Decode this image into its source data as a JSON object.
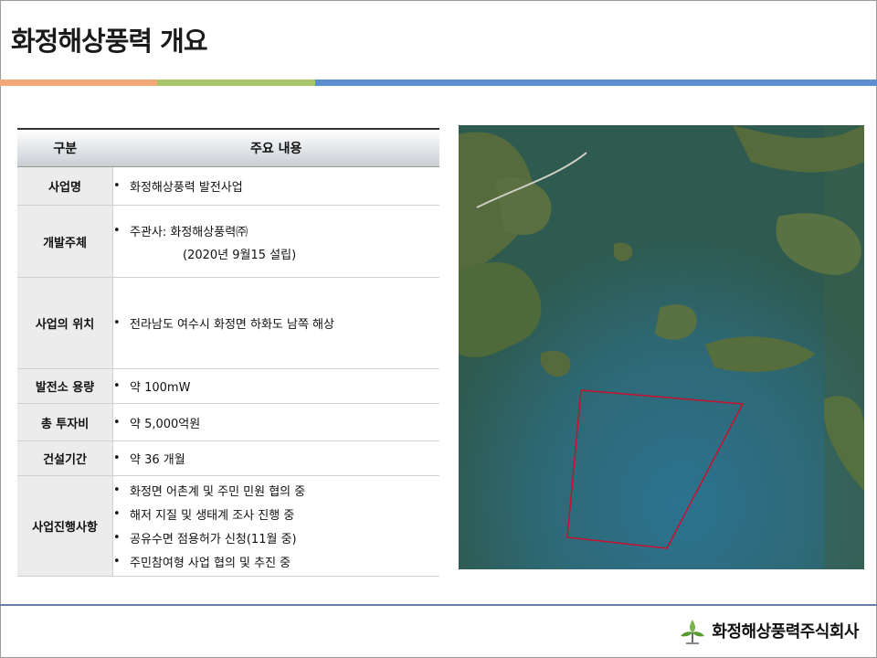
{
  "page": {
    "title": "화정해상풍력 개요"
  },
  "table": {
    "headers": [
      "구분",
      "주요 내용"
    ],
    "rows": [
      {
        "category": "사업명",
        "items": [
          "화정해상풍력 발전사업"
        ]
      },
      {
        "category": "개발주체",
        "items": [
          "주관사: 화정해상풍력㈜"
        ],
        "sub": "(2020년   9월15 설립)"
      },
      {
        "category": "사업의 위치",
        "items": [
          "전라남도 여수시 화정면 하화도 남쪽 해상"
        ]
      },
      {
        "category": "발전소 용량",
        "items": [
          "약 100mW"
        ]
      },
      {
        "category": "총 투자비",
        "items": [
          "약 5,000억원"
        ]
      },
      {
        "category": "건설기간",
        "items": [
          "약 36 개월"
        ]
      },
      {
        "category": "사업진행사항",
        "items": [
          "화정면 어촌계 및 주민 민원 협의 중",
          "해저 지질 및 생태계 조사 진행 중",
          "공유수면 점용허가 신청(11월 중)",
          "주민참여형 사업 협의 및 추진 중"
        ]
      }
    ],
    "bullet": "•"
  },
  "map": {
    "image": "satellite-map",
    "boundary_color": "#c8102e"
  },
  "footer": {
    "company": "화정해상풍력주식회사",
    "logo": "wind-turbine-logo"
  }
}
